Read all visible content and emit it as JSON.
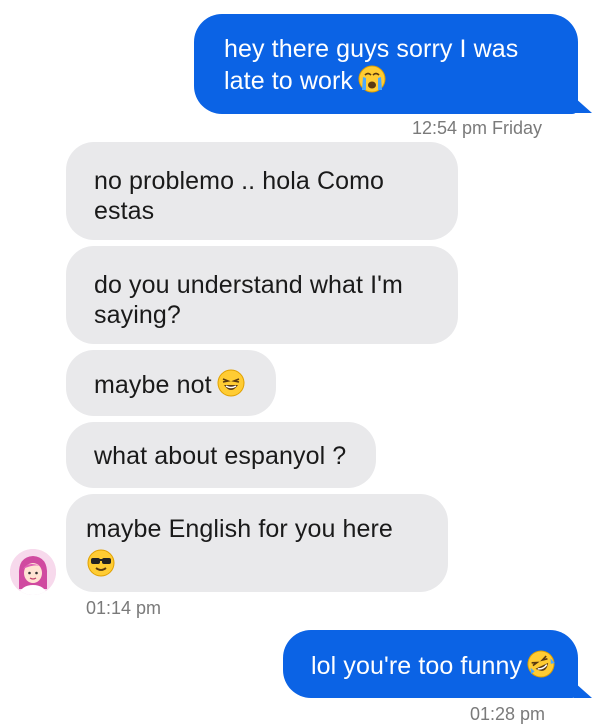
{
  "messages": [
    {
      "id": "m1",
      "text": "hey there guys sorry I was late to work",
      "emoji": "crying-face-emoji"
    },
    {
      "id": "m2",
      "text": "no problemo .. hola Como estas"
    },
    {
      "id": "m3",
      "text": "do you understand what I'm saying?"
    },
    {
      "id": "m4",
      "text": "maybe not",
      "emoji": "laughing-face-emoji"
    },
    {
      "id": "m5",
      "text": "what about espanyol ?"
    },
    {
      "id": "m6",
      "text": "maybe English for you here",
      "emoji": "sunglasses-face-emoji"
    },
    {
      "id": "m7",
      "text": "lol you're too funny",
      "emoji": "rolling-laughing-face-emoji"
    }
  ],
  "timestamps": {
    "t1": "12:54 pm Friday",
    "t2": "01:14 pm",
    "t3": "01:28 pm"
  },
  "colors": {
    "outgoing_bubble": "#0b63e5",
    "incoming_bubble": "#e9e9eb",
    "timestamp": "#7a7a7a"
  }
}
